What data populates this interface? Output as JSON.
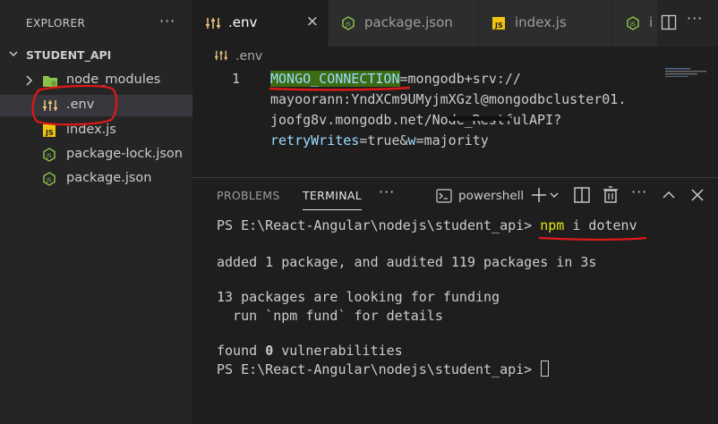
{
  "explorer": {
    "title": "EXPLORER",
    "more": "···",
    "folder_name": "STUDENT_API",
    "items": [
      {
        "label": "node_modules",
        "icon": "folder-icon"
      },
      {
        "label": ".env",
        "icon": "settings-file-icon"
      },
      {
        "label": "index.js",
        "icon": "js-file-icon"
      },
      {
        "label": "package-lock.json",
        "icon": "nodejs-file-icon"
      },
      {
        "label": "package.json",
        "icon": "nodejs-file-icon"
      }
    ]
  },
  "tabs": [
    {
      "label": ".env",
      "icon": "settings-file-icon",
      "active": true,
      "close": "×"
    },
    {
      "label": "package.json",
      "icon": "nodejs-file-icon",
      "active": false
    },
    {
      "label": "index.js",
      "icon": "js-file-icon",
      "active": false
    },
    {
      "label": "i",
      "icon": "nodejs-file-icon",
      "active": false
    }
  ],
  "breadcrumb": {
    "label": ".env"
  },
  "editor": {
    "line_number": "1",
    "lines": [
      {
        "key": "MONGO_CONNECTION",
        "rest": "=mongodb+srv://"
      },
      {
        "text": "mayoorann:YndXCm9UMyjmXGzl@mongodbcluster01."
      },
      {
        "text": "joofg8v.mongodb.net/Node_RestfulAPI?"
      },
      {
        "key": "retryWrites",
        "eq1": "=true&",
        "key2": "w",
        "eq2": "=majority"
      }
    ]
  },
  "panel": {
    "tabs": [
      "PROBLEMS",
      "TERMINAL"
    ],
    "active_tab": "TERMINAL",
    "more": "···",
    "terminal_name": "powershell",
    "terminal": {
      "prompt": "PS E:\\React-Angular\\nodejs\\student_api> ",
      "cmd": "npm",
      "cmd_args": " i dotenv",
      "line_added": "added 1 package, and audited 119 packages in 3s",
      "line_funding": "13 packages are looking for funding",
      "line_fund": "  run `npm fund` for details",
      "found_prefix": "found ",
      "found_count": "0",
      "found_suffix": " vulnerabilities"
    }
  },
  "colors": {
    "accent_green_highlight": "#3c6b14",
    "annotation_red": "#e01818",
    "key_blue": "#9cdcfe",
    "cmd_yellow": "#e5e510"
  }
}
